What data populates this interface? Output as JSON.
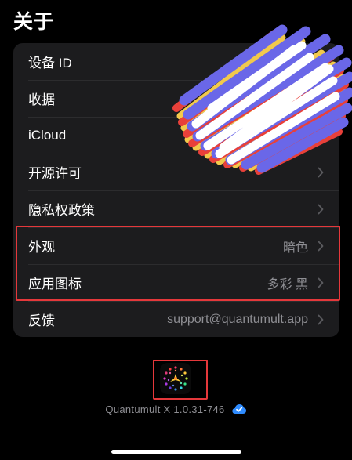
{
  "page": {
    "title": "关于"
  },
  "settings": {
    "rows": [
      {
        "label": "设备 ID",
        "value": "",
        "chevron": false
      },
      {
        "label": "收据",
        "value": "",
        "chevron": false
      },
      {
        "label": "iCloud",
        "value": "",
        "chevron": false
      },
      {
        "label": "开源许可",
        "value": "",
        "chevron": true
      },
      {
        "label": "隐私权政策",
        "value": "",
        "chevron": true
      },
      {
        "label": "外观",
        "value": "暗色",
        "chevron": true
      },
      {
        "label": "应用图标",
        "value": "多彩 黑",
        "chevron": true
      },
      {
        "label": "反馈",
        "value": "support@quantumult.app",
        "chevron": true
      }
    ]
  },
  "footer": {
    "version": "Quantumult X 1.0.31-746",
    "badge_icon": "verified-badge-icon",
    "app_icon": "quantumult-app-icon"
  },
  "colors": {
    "background": "#000000",
    "card": "#1c1c1e",
    "secondary_text": "#8e8e93",
    "highlight": "#e5383b",
    "verified": "#2f8cff"
  }
}
